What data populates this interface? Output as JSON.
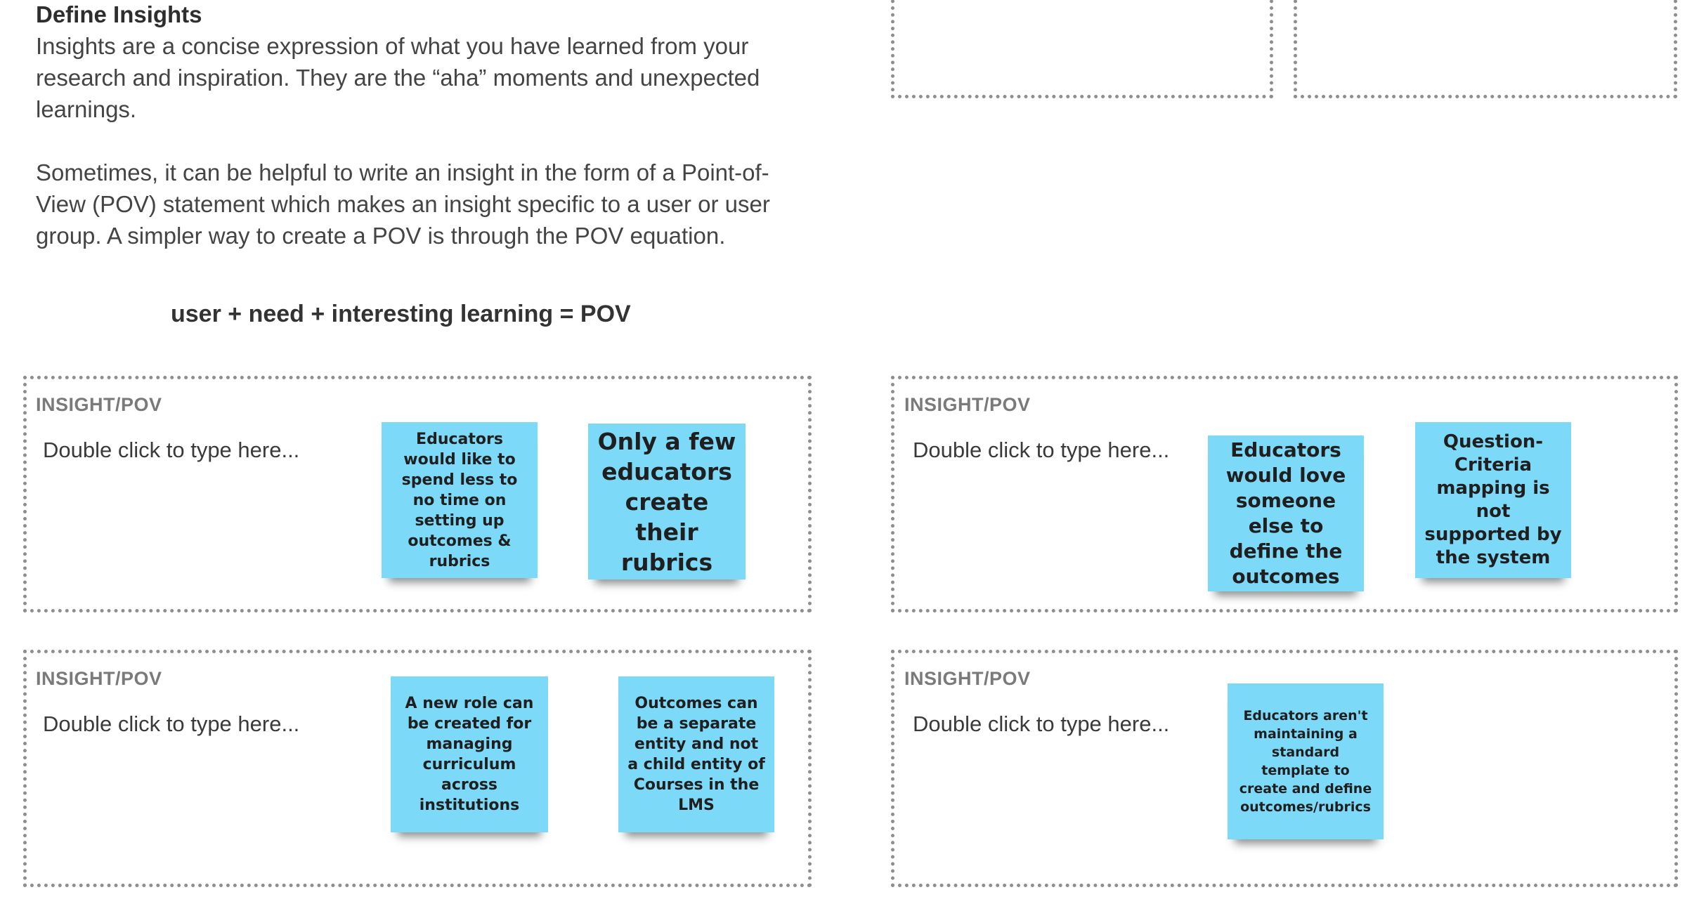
{
  "intro": {
    "title": "Define Insights",
    "paragraph1": "Insights are a concise expression of what you have learned from your research and inspiration. They are the “aha” moments and unexpected learnings.",
    "paragraph2": "Sometimes, it can be helpful to write an insight in the form of a Point-of-View (POV) statement which makes an insight specific to a user or user group. A simpler way to create a POV is through the POV equation.",
    "equation": "user + need + interesting learning = POV"
  },
  "frames": [
    {
      "label": "INSIGHT/POV",
      "placeholder": "Double click to type here...",
      "stickies": [
        "Educators would like to spend less to no time on setting up outcomes & rubrics",
        "Only a few educators create their rubrics"
      ]
    },
    {
      "label": "INSIGHT/POV",
      "placeholder": "Double click to type here...",
      "stickies": [
        "Educators would love someone else to define the outcomes",
        "Question-Criteria mapping is not supported by the system"
      ]
    },
    {
      "label": "INSIGHT/POV",
      "placeholder": "Double click to type here...",
      "stickies": [
        "A new role can be created for managing curriculum across institutions",
        "Outcomes can be a separate entity and not a child entity of Courses in the LMS"
      ]
    },
    {
      "label": "INSIGHT/POV",
      "placeholder": "Double click to type here...",
      "stickies": [
        "Educators aren't maintaining a standard template to create and define outcomes/rubrics"
      ]
    }
  ],
  "colors": {
    "sticky": "#7dd9f8",
    "frame_border": "#8e8e8e"
  }
}
